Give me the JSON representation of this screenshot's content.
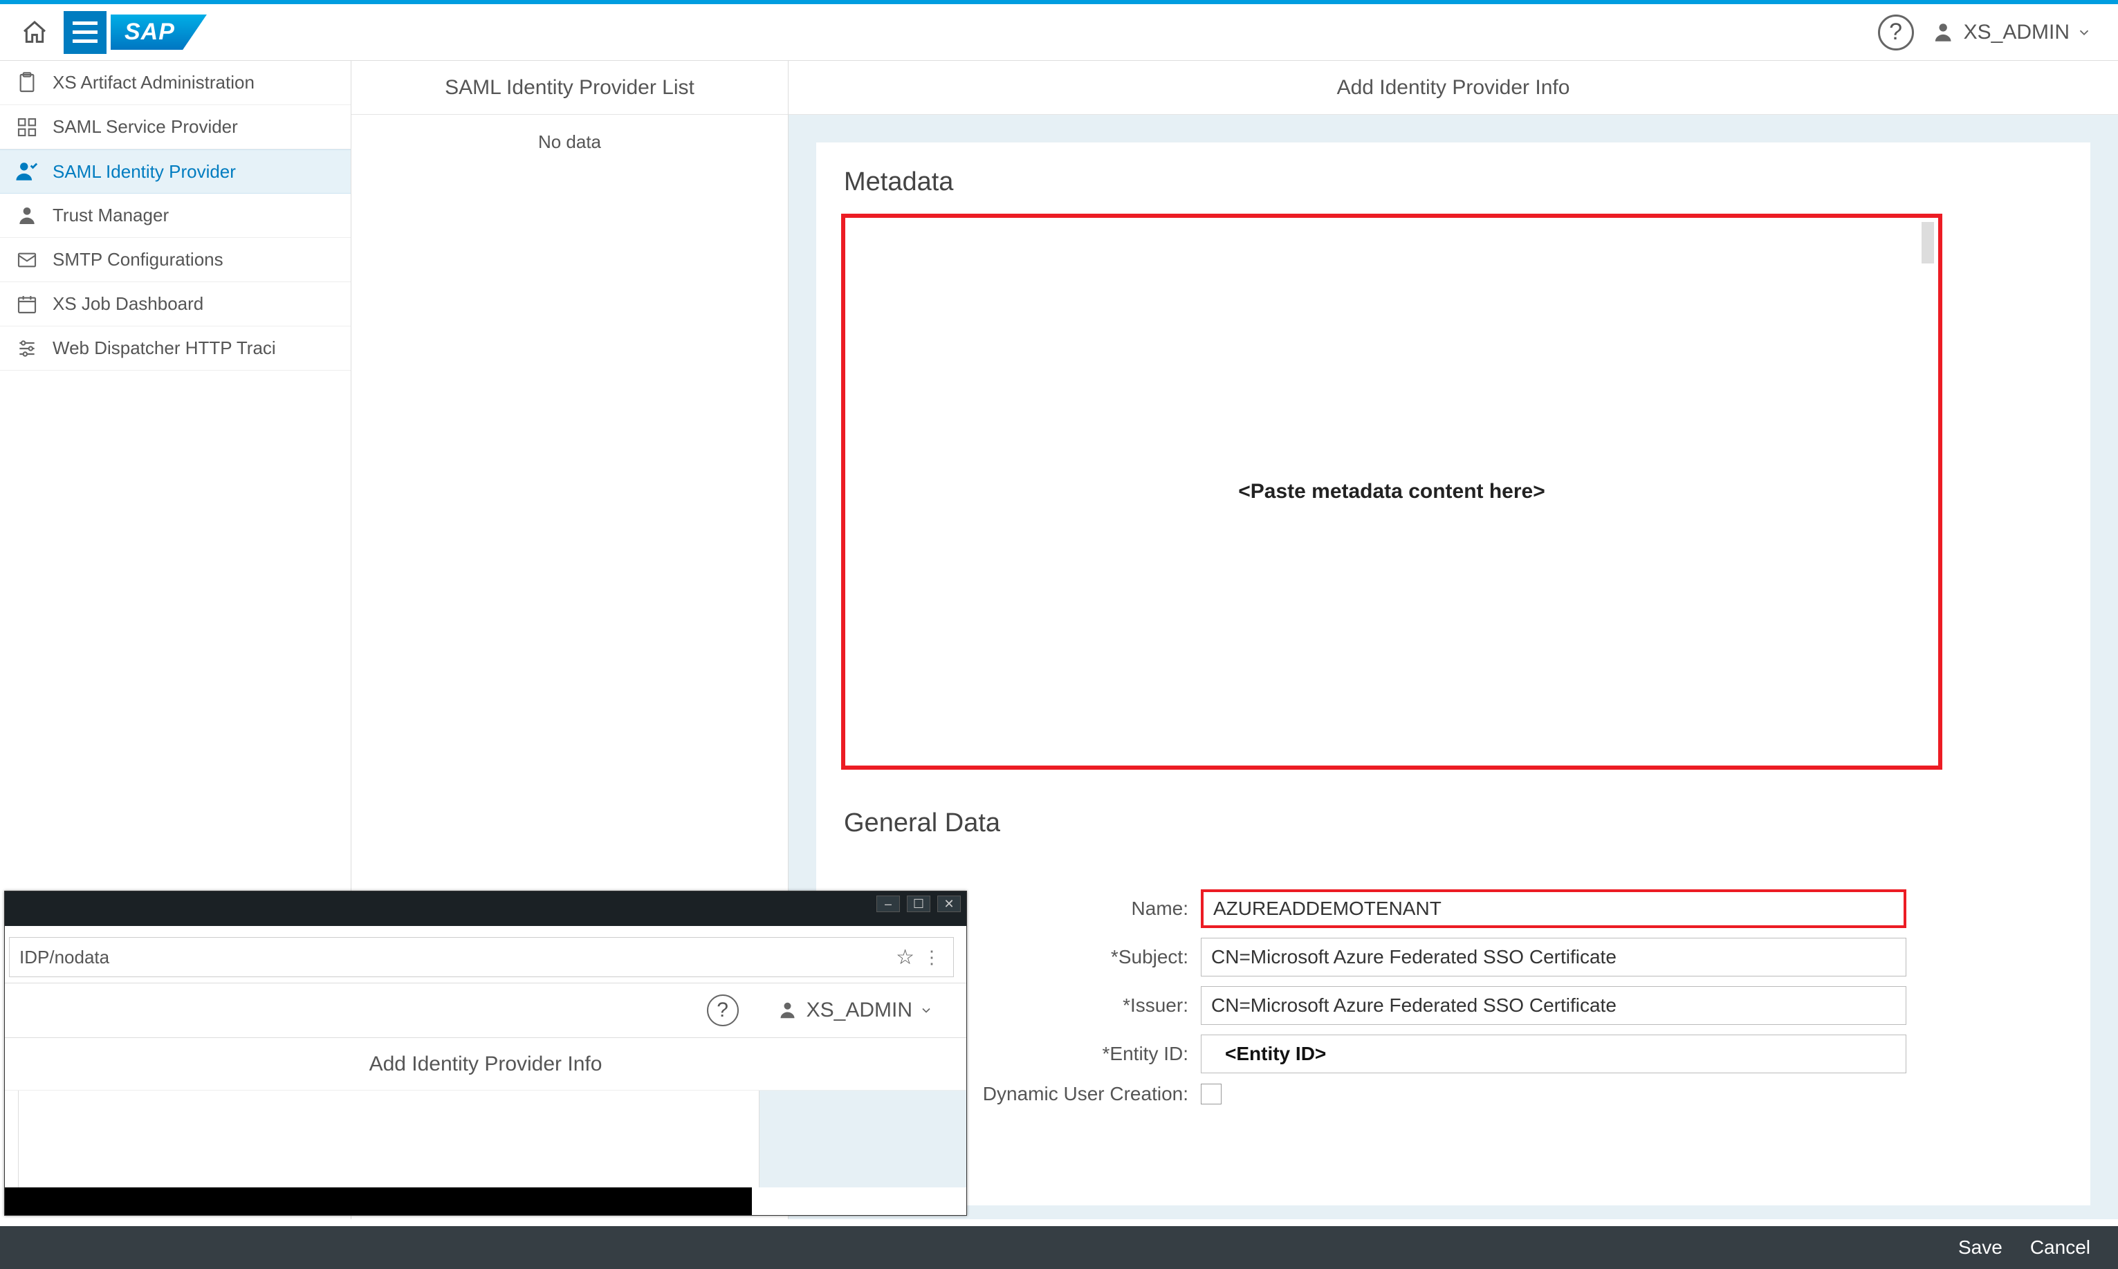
{
  "topbar": {
    "user_label": "XS_ADMIN"
  },
  "sidebar": {
    "items": [
      {
        "label": "XS Artifact Administration"
      },
      {
        "label": "SAML Service Provider"
      },
      {
        "label": "SAML Identity Provider"
      },
      {
        "label": "Trust Manager"
      },
      {
        "label": "SMTP Configurations"
      },
      {
        "label": "XS Job Dashboard"
      },
      {
        "label": "Web Dispatcher HTTP Traci"
      }
    ]
  },
  "midcol": {
    "title": "SAML Identity Provider List",
    "empty_text": "No data"
  },
  "content": {
    "title": "Add Identity Provider Info",
    "sections": {
      "metadata_title": "Metadata",
      "metadata_placeholder": "<Paste metadata content here>",
      "general_title": "General Data"
    },
    "form": {
      "name_label": "Name:",
      "name_value": "AZUREADDEMOTENANT",
      "subject_label": "*Subject:",
      "subject_value": "CN=Microsoft Azure Federated SSO Certificate",
      "issuer_label": "*Issuer:",
      "issuer_value": "CN=Microsoft Azure Federated SSO Certificate",
      "entity_label": "*Entity ID:",
      "entity_value": "<Entity ID>",
      "dyn_label": "Dynamic User Creation:"
    }
  },
  "footer": {
    "save": "Save",
    "cancel": "Cancel"
  },
  "popup": {
    "url": "IDP/nodata",
    "user_label": "XS_ADMIN",
    "header": "Add Identity Provider Info"
  }
}
